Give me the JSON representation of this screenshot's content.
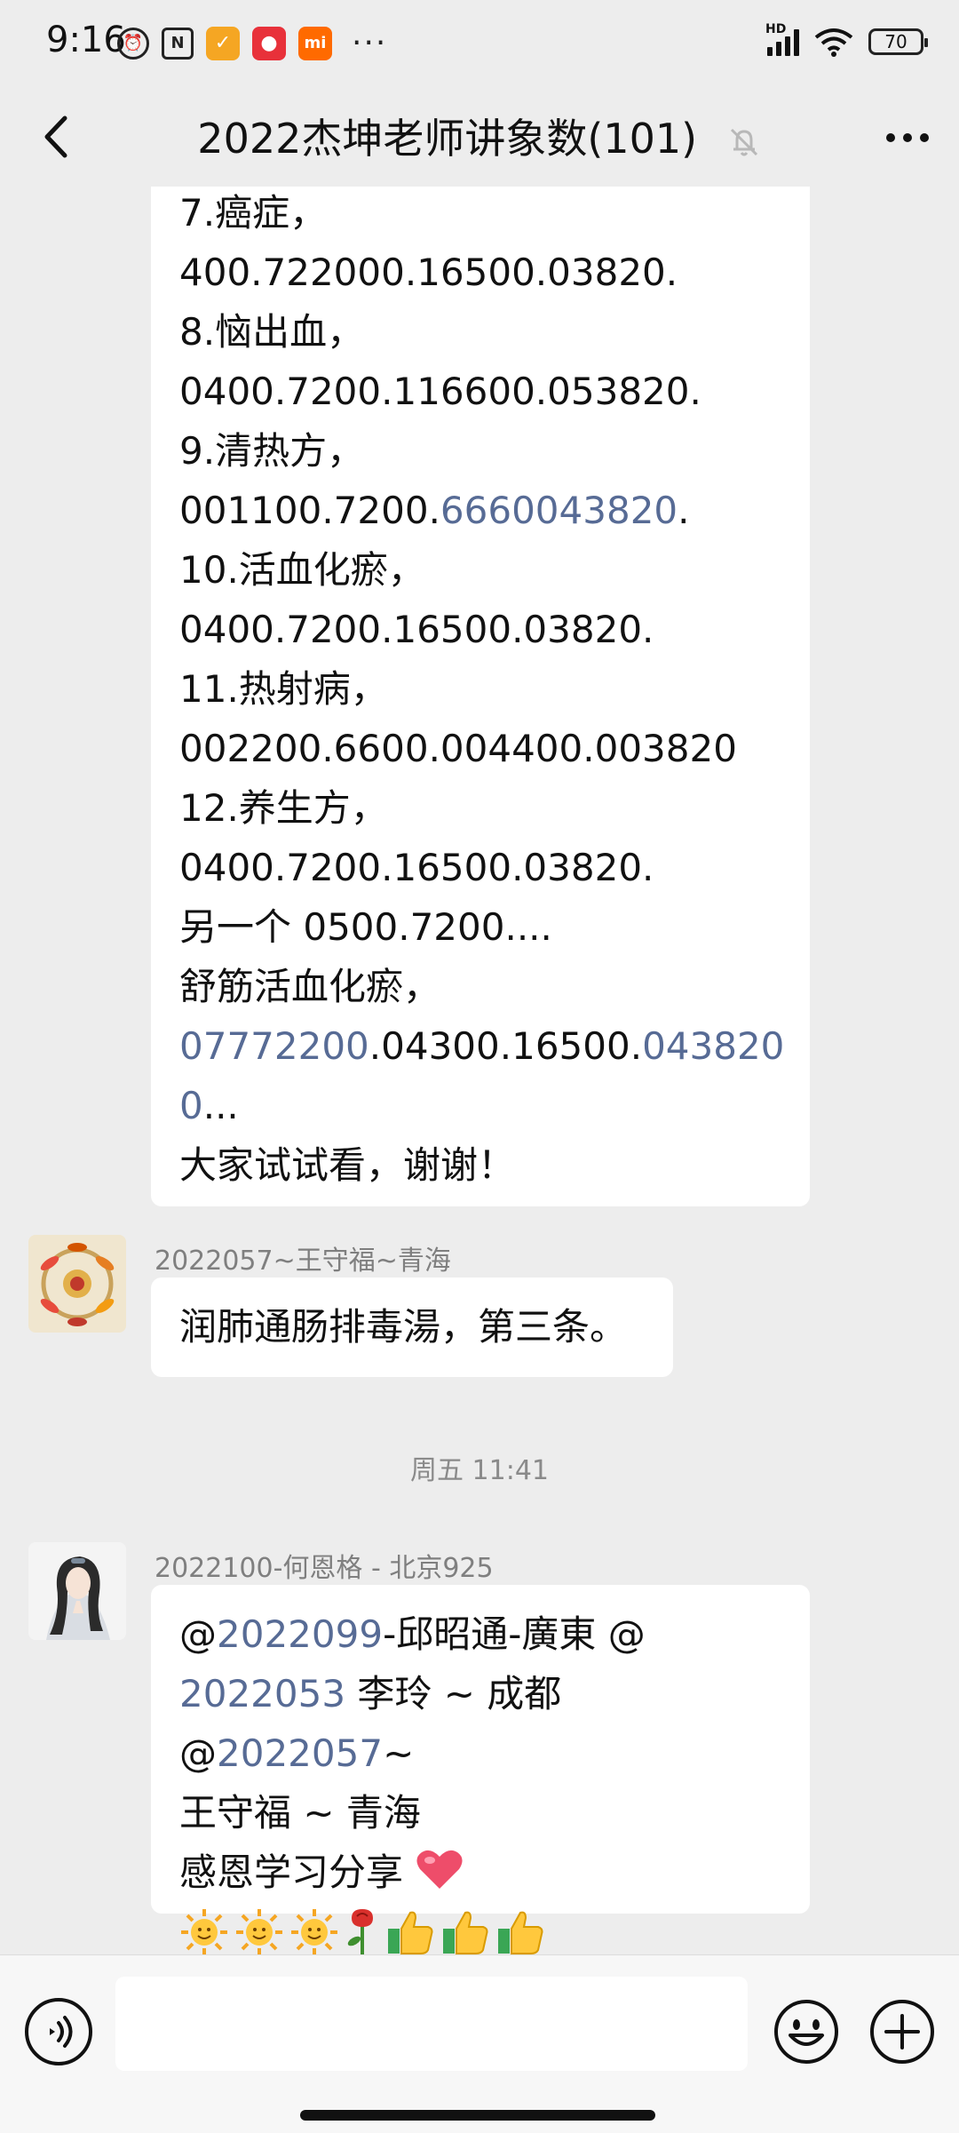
{
  "status_bar": {
    "time": "9:16",
    "battery": "70",
    "network": "HD",
    "more": "···"
  },
  "header": {
    "title": "2022杰坤老师讲象数(101)",
    "back_icon": "chevron-left-icon",
    "mute_icon": "bell-off-icon",
    "more_icon": "more-dots-icon"
  },
  "messages": {
    "first": {
      "lines": [
        "7.癌症，",
        "400.722000.16500.03820.",
        "8.恼出血，",
        "0400.7200.116600.053820.",
        "9.清热方，",
        {
          "plain": "001100.7200.",
          "link": "6660043820",
          "tail": "."
        },
        "10.活血化瘀，",
        "0400.7200.16500.03820.",
        "11.热射病，",
        "002200.6600.004400.003820",
        "12.养生方，",
        "0400.7200.16500.03820.",
        "另一个 0500.7200....",
        "舒筋活血化瘀，",
        {
          "link": "07772200",
          "plain": ".04300.16500.",
          "link2": "043820"
        },
        {
          "link": "0",
          "plain": "..."
        },
        "大家试试看，谢谢！"
      ]
    },
    "second": {
      "sender": "2022057~王守福~青海",
      "text": "润肺通肠排毒湯，第三条。"
    },
    "timestamp": "周五 11:41",
    "third": {
      "sender": "2022100-何恩格 - 北京925",
      "line1": {
        "at": "@",
        "link": "2022099",
        "plain": "-邱昭通-廣東  @"
      },
      "line2": {
        "link": "2022053",
        "plain": " 李玲 ~ 成都  @",
        "link2": "2022057",
        "tail": "~"
      },
      "line3": "王守福 ~ 青海",
      "line4": "感恩学习分享",
      "emoji_line": [
        "sun",
        "sun",
        "sun",
        "rose",
        "thumbs-up",
        "thumbs-up",
        "thumbs-up"
      ]
    }
  },
  "input_bar": {
    "voice_icon": "voice-icon",
    "emoji_icon": "emoji-icon",
    "plus_icon": "plus-icon",
    "placeholder": ""
  }
}
